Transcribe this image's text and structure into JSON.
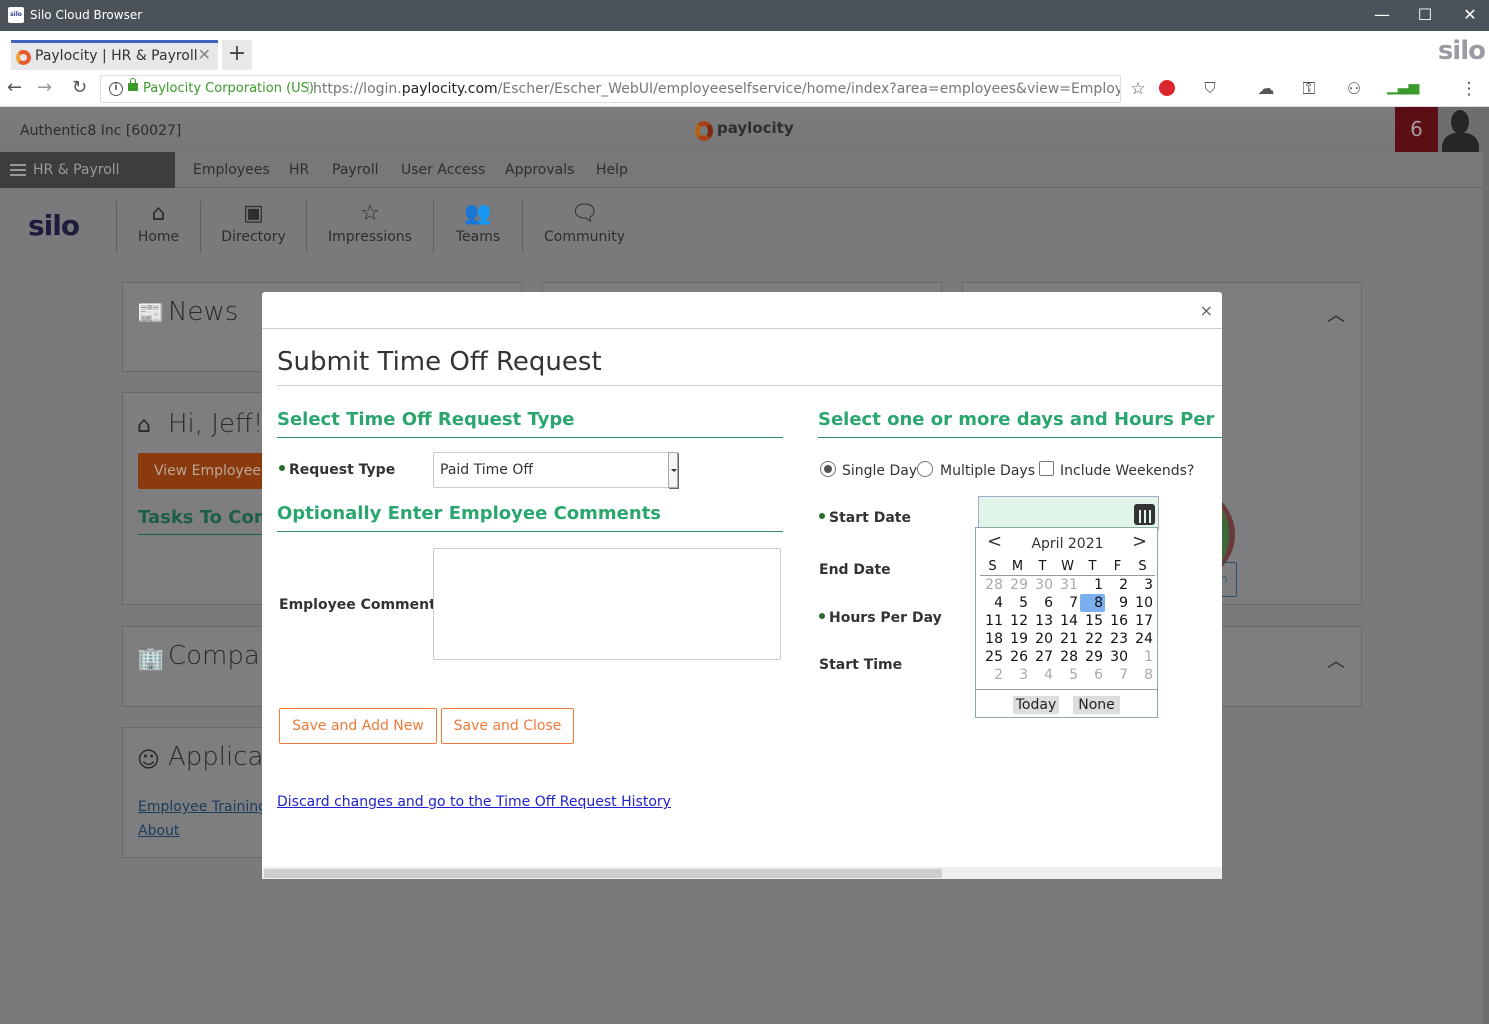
{
  "window": {
    "app_icon_text": "silo",
    "title": "Silo Cloud Browser",
    "minimize": "—",
    "maximize": "☐",
    "close": "✕"
  },
  "browser": {
    "tab_label": "Paylocity | HR & Payroll",
    "tab_close": "✕",
    "new_tab": "+",
    "brand": "silo",
    "back": "←",
    "forward": "→",
    "reload": "↻",
    "info": "i",
    "site_identity": "Paylocity Corporation (US)",
    "url_prefix": "https://login.",
    "url_domain": "paylocity.com",
    "url_path": "/Escher/Escher_WebUI/employeeselfservice/home/index?area=employees&view=EmployeePo",
    "toolbar_icons": {
      "star": "☆",
      "block": "⛔",
      "bookmark": "🔖",
      "cloud": "☁",
      "key": "⚿",
      "user": "👤",
      "signal": "📶",
      "menu": "⋮"
    }
  },
  "header": {
    "company": "Authentic8 Inc [60027]",
    "logo_text": "paylocity",
    "notification_count": "6",
    "product_menu": "HR & Payroll",
    "top_nav": [
      "Employees",
      "HR",
      "Payroll",
      "User Access",
      "Approvals",
      "Help"
    ],
    "silo_logo": "silo",
    "quick_nav": [
      {
        "label": "Home",
        "icon": "⌂"
      },
      {
        "label": "Directory",
        "icon": "▣"
      },
      {
        "label": "Impressions",
        "icon": "☆"
      },
      {
        "label": "Teams",
        "icon": "👥"
      },
      {
        "label": "Community",
        "icon": "🗨"
      }
    ]
  },
  "background_cards": {
    "news": {
      "title": "News",
      "icon": "📰"
    },
    "greeting": {
      "title": "Hi, Jeff!",
      "icon": "⌂",
      "button": "View Employee P",
      "tasks": "Tasks To Comp"
    },
    "company": {
      "title": "Compan",
      "icon": "🏢"
    },
    "applications": {
      "title": "Applicat",
      "icon": "☺",
      "links": [
        "Employee Training",
        "About"
      ]
    },
    "collapse_icon": "︿",
    "blue_fragment": "n"
  },
  "modal": {
    "close": "×",
    "title": "Submit Time Off Request",
    "section_type": "Select Time Off Request Type",
    "request_type_label": "Request Type",
    "request_type_value": "Paid Time Off",
    "section_comments": "Optionally Enter Employee Comments",
    "comments_label": "Employee Comments",
    "comments_value": "",
    "save_add_new": "Save and Add New",
    "save_close": "Save and Close",
    "discard_link": "Discard changes and go to the Time Off Request History",
    "section_days": "Select one or more days and Hours Per Day / ",
    "day_mode_options": [
      {
        "label": "Single Day",
        "selected": true
      },
      {
        "label": "Multiple Days",
        "selected": false
      }
    ],
    "include_weekends_label": "Include Weekends?",
    "include_weekends_checked": false,
    "start_date_label": "Start Date",
    "start_date_value": "",
    "end_date_label": "End Date",
    "hours_per_day_label": "Hours Per Day",
    "start_time_label": "Start Time"
  },
  "datepicker": {
    "prev": "<",
    "next": ">",
    "month_year": "April 2021",
    "weekdays": [
      "S",
      "M",
      "T",
      "W",
      "T",
      "F",
      "S"
    ],
    "weeks": [
      [
        {
          "d": "28",
          "o": true
        },
        {
          "d": "29",
          "o": true
        },
        {
          "d": "30",
          "o": true
        },
        {
          "d": "31",
          "o": true
        },
        {
          "d": "1"
        },
        {
          "d": "2"
        },
        {
          "d": "3"
        }
      ],
      [
        {
          "d": "4"
        },
        {
          "d": "5"
        },
        {
          "d": "6"
        },
        {
          "d": "7"
        },
        {
          "d": "8",
          "sel": true
        },
        {
          "d": "9"
        },
        {
          "d": "10"
        }
      ],
      [
        {
          "d": "11"
        },
        {
          "d": "12"
        },
        {
          "d": "13"
        },
        {
          "d": "14"
        },
        {
          "d": "15"
        },
        {
          "d": "16"
        },
        {
          "d": "17"
        }
      ],
      [
        {
          "d": "18"
        },
        {
          "d": "19"
        },
        {
          "d": "20"
        },
        {
          "d": "21"
        },
        {
          "d": "22"
        },
        {
          "d": "23"
        },
        {
          "d": "24"
        }
      ],
      [
        {
          "d": "25"
        },
        {
          "d": "26"
        },
        {
          "d": "27"
        },
        {
          "d": "28"
        },
        {
          "d": "29"
        },
        {
          "d": "30"
        },
        {
          "d": "1",
          "o": true
        }
      ],
      [
        {
          "d": "2",
          "o": true
        },
        {
          "d": "3",
          "o": true
        },
        {
          "d": "4",
          "o": true
        },
        {
          "d": "5",
          "o": true
        },
        {
          "d": "6",
          "o": true
        },
        {
          "d": "7",
          "o": true
        },
        {
          "d": "8",
          "o": true
        }
      ]
    ],
    "today": "Today",
    "none": "None"
  }
}
